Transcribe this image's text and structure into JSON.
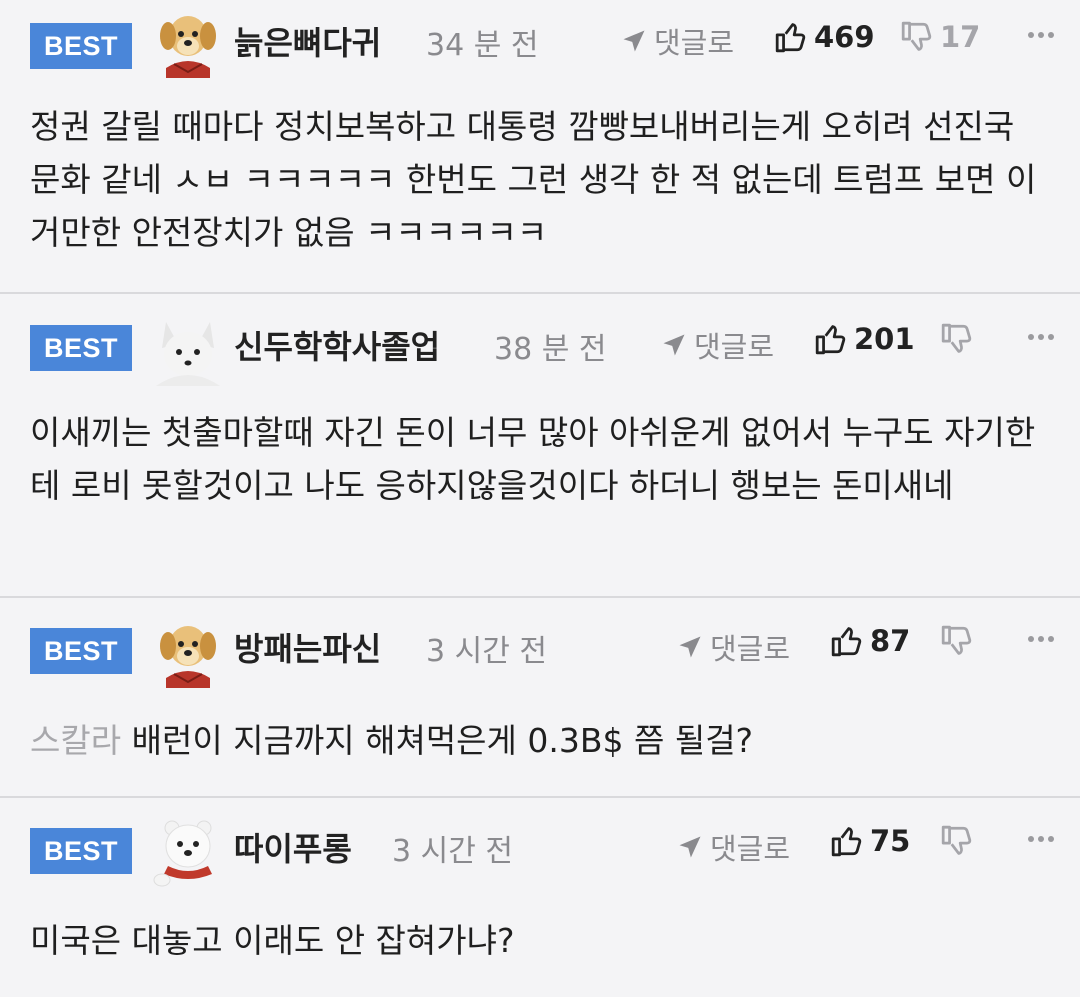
{
  "comments": [
    {
      "badge": "BEST",
      "avatar": "puppy-avatar",
      "nick": "늙은뼈다귀",
      "time": "34 분 전",
      "reply": "댓글로",
      "up": "469",
      "down": "17",
      "quote": "",
      "text": "정권 갈릴 때마다 정치보복하고 대통령 깜빵보내버리는게 오히려 선진국 문화 같네 ㅅㅂ ㅋㅋㅋㅋㅋ 한번도 그런 생각 한 적 없는데 트럼프 보면 이거만한 안전장치가 없음 ㅋㅋㅋㅋㅋㅋ"
    },
    {
      "badge": "BEST",
      "avatar": "arctic-fox-avatar",
      "nick": "신두학학사졸업",
      "time": "38 분 전",
      "reply": "댓글로",
      "up": "201",
      "down": "",
      "quote": "",
      "text": "이새끼는 첫출마할때 자긴 돈이 너무 많아 아쉬운게 없어서 누구도 자기한테 로비 못할것이고 나도 응하지않을것이다 하더니 행보는 돈미새네"
    },
    {
      "badge": "BEST",
      "avatar": "puppy-avatar",
      "nick": "방패는파신",
      "time": "3 시간 전",
      "reply": "댓글로",
      "up": "87",
      "down": "",
      "quote": "스칼라",
      "text": "배런이 지금까지 해쳐먹은게 0.3B$ 쯤 될걸?"
    },
    {
      "badge": "BEST",
      "avatar": "polar-bear-avatar",
      "nick": "따이푸롱",
      "time": "3 시간 전",
      "reply": "댓글로",
      "up": "75",
      "down": "",
      "quote": "",
      "text": "미국은 대놓고 이래도 안 잡혀가냐?"
    }
  ],
  "colors": {
    "badge": "#4a86d9",
    "muted": "#8a8a8e",
    "divider": "#d9d9dc"
  }
}
